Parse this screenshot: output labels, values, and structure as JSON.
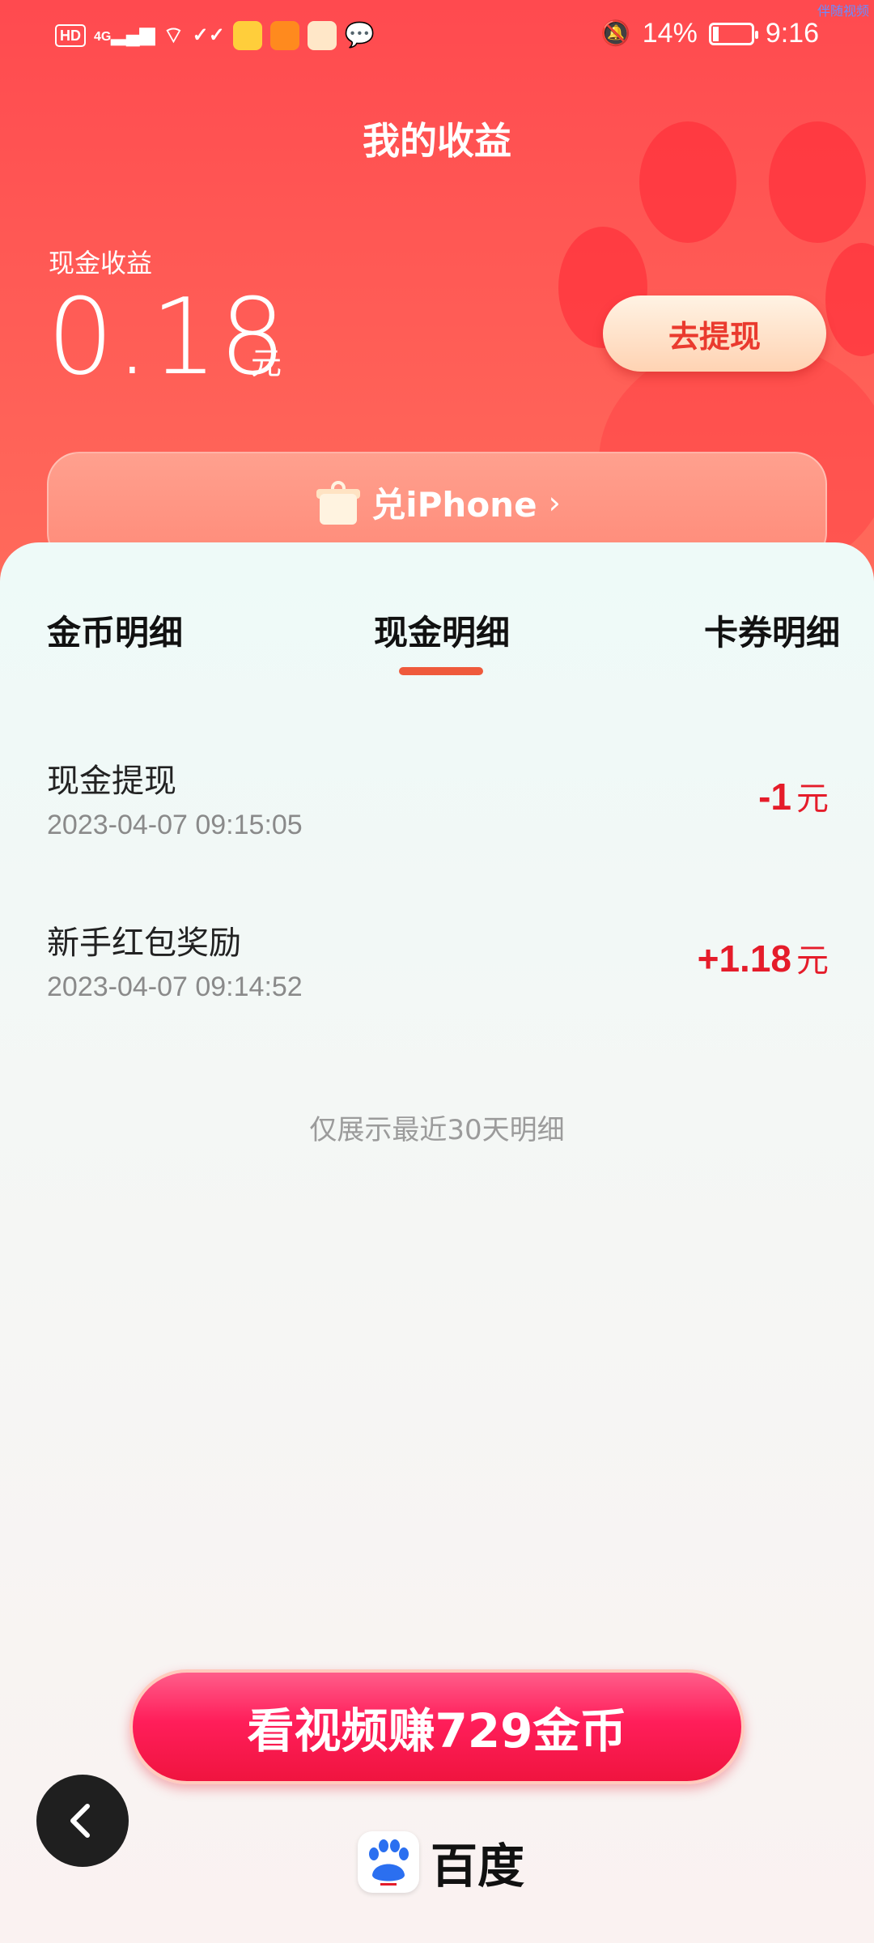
{
  "status_bar": {
    "hd": "HD",
    "signal": "4G",
    "battery_percent": "14%",
    "time": "9:16",
    "battery_level": 0.14
  },
  "corner_tag": "伴随视频",
  "header": {
    "title": "我的收益",
    "cash_label": "现金收益",
    "cash_value": "0.18",
    "cash_unit": "元",
    "withdraw_label": "去提现",
    "promo_label": "兑iPhone"
  },
  "tabs": [
    {
      "label": "金币明细",
      "active": false
    },
    {
      "label": "现金明细",
      "active": true
    },
    {
      "label": "卡券明细",
      "active": false
    }
  ],
  "transactions": [
    {
      "title": "现金提现",
      "time": "2023-04-07 09:15:05",
      "amount": "-1",
      "unit": "元"
    },
    {
      "title": "新手红包奖励",
      "time": "2023-04-07 09:14:52",
      "amount": "+1.18",
      "unit": "元"
    }
  ],
  "footer_note": "仅展示最近30天明细",
  "earn_button": "看视频赚729金币",
  "brand": "百度",
  "colors": {
    "accent_red": "#e51c2a",
    "header_red": "#ff4a4f",
    "tab_underline": "#ef5a3c",
    "earn_button": "#ff1e5a"
  }
}
